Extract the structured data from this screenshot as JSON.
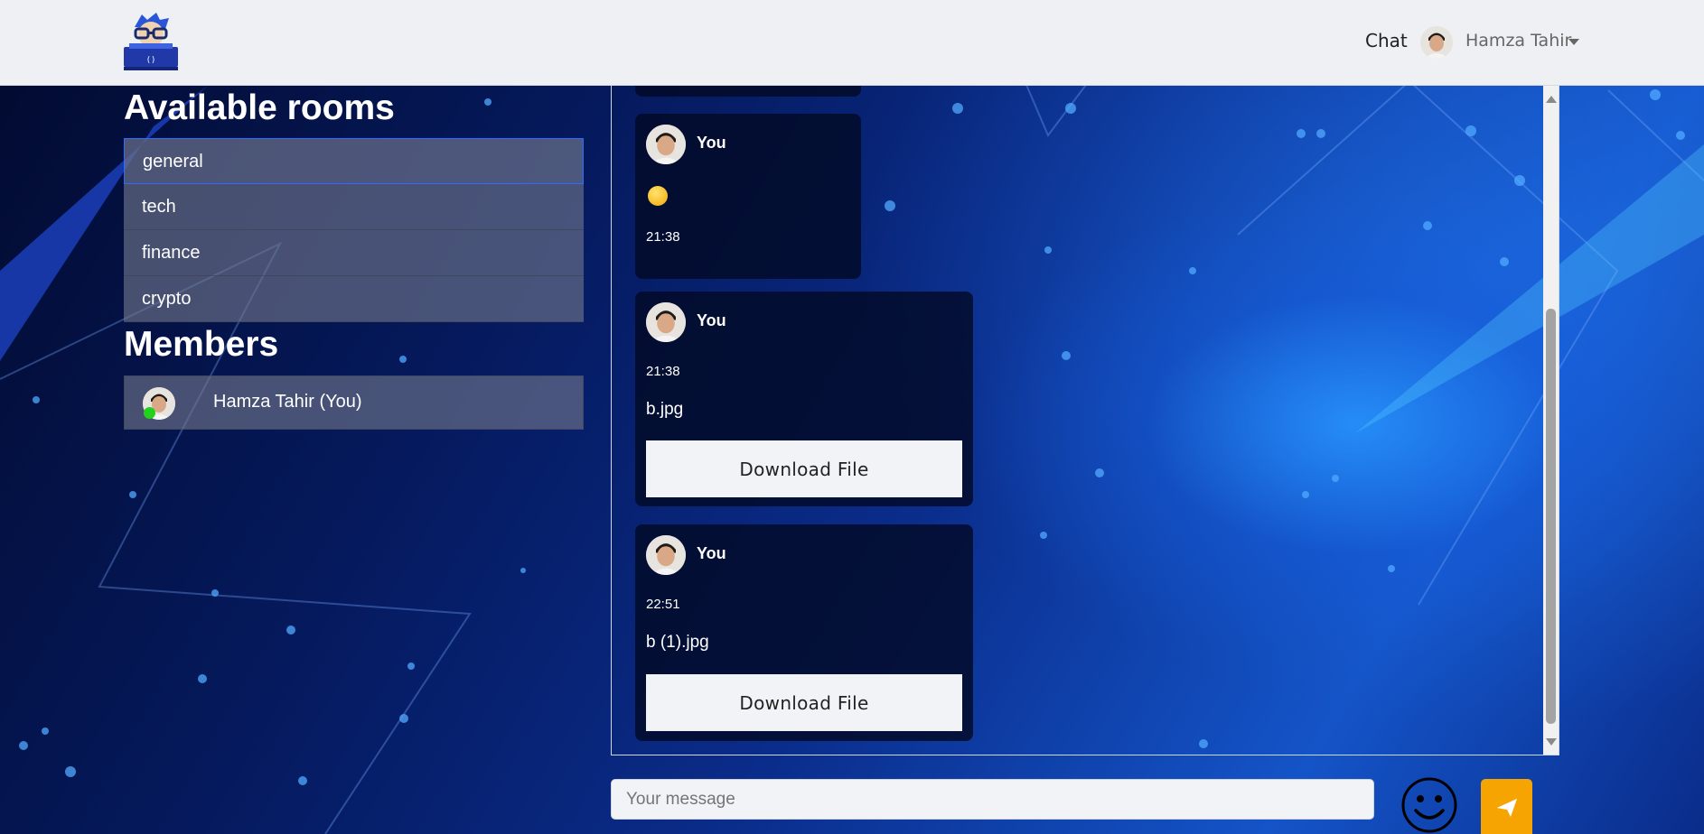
{
  "navbar": {
    "logo_icon": "coder-glasses-laptop-logo",
    "chat_link": "Chat",
    "user_name": "Hamza Tahir"
  },
  "rooms": {
    "heading": "Available rooms",
    "items": [
      {
        "label": "general",
        "active": true
      },
      {
        "label": "tech",
        "active": false
      },
      {
        "label": "finance",
        "active": false
      },
      {
        "label": "crypto",
        "active": false
      }
    ]
  },
  "members": {
    "heading": "Members",
    "items": [
      {
        "name": "Hamza Tahir (You)",
        "status": "online",
        "status_color": "#22d11c"
      }
    ]
  },
  "messages": [
    {
      "sender": "You",
      "type": "emoji",
      "emoji": "😛",
      "time": "21:38"
    },
    {
      "sender": "You",
      "type": "file",
      "time": "21:38",
      "file_name": "b.jpg",
      "button_label": "Download File"
    },
    {
      "sender": "You",
      "type": "file",
      "time": "22:51",
      "file_name": "b (1).jpg",
      "button_label": "Download File"
    }
  ],
  "composer": {
    "placeholder": "Your message",
    "emoji_icon": "smiley-face-icon",
    "send_icon": "paper-plane-icon",
    "send_color": "#f5a402"
  }
}
